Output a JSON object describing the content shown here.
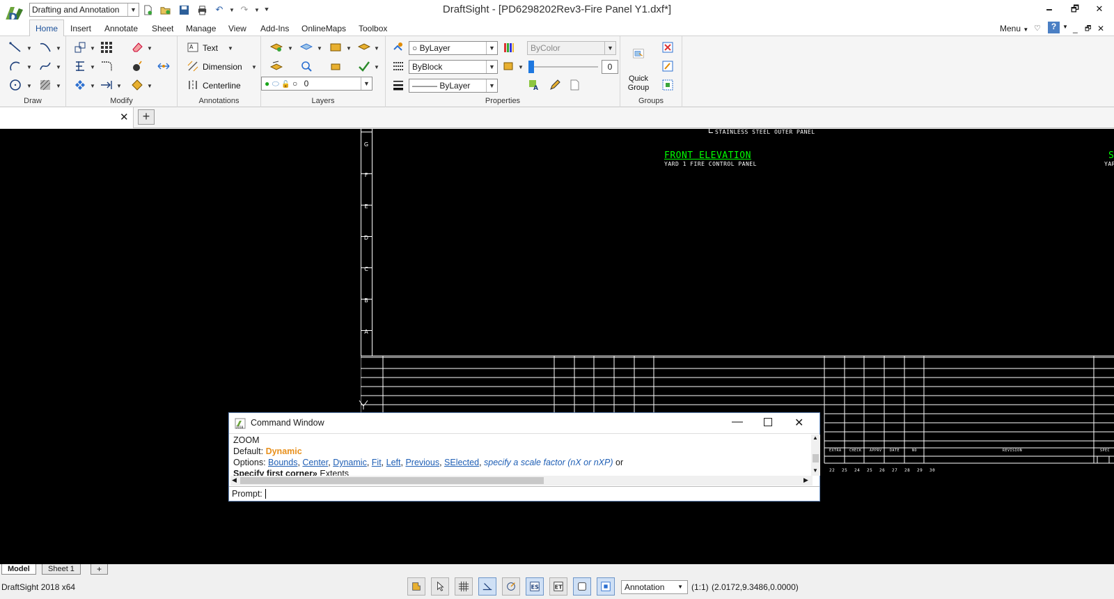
{
  "app": {
    "title": "DraftSight - [PD6298202Rev3-Fire Panel Y1.dxf*]",
    "workspace": "Drafting and Annotation",
    "menu_label": "Menu"
  },
  "ribbon_tabs": [
    "Home",
    "Insert",
    "Annotate",
    "Sheet",
    "Manage",
    "View",
    "Add-Ins",
    "OnlineMaps",
    "Toolbox"
  ],
  "ribbon": {
    "panels": {
      "draw": "Draw",
      "modify": "Modify",
      "annotations": "Annotations",
      "layers": "Layers",
      "properties": "Properties",
      "groups": "Groups"
    },
    "annotations": {
      "text": "Text",
      "dimension": "Dimension",
      "centerline": "Centerline"
    },
    "layers": {
      "current_layer": "0"
    },
    "properties": {
      "color": "ByLayer",
      "linetype": "ByBlock",
      "lineweight": "ByLayer",
      "plot_style": "ByColor",
      "transparency": "0"
    },
    "groups": {
      "quick_group_line1": "Quick",
      "quick_group_line2": "Group"
    }
  },
  "drawing": {
    "outer_panel_note": "STAINLESS STEEL OUTER PANEL",
    "title": "FRONT ELEVATION",
    "subtitle": "YARD 1 FIRE CONTROL PANEL",
    "right_cut_title": "S",
    "right_cut_sub": "YAR",
    "row_labels": [
      "G",
      "F",
      "E",
      "D",
      "C",
      "B",
      "A"
    ],
    "table_headers": [
      "EXTRA",
      "CHECK",
      "APPRV",
      "DATE",
      "NO",
      "REVISION",
      "SPEC"
    ],
    "column_numbers": [
      "22",
      "25",
      "24",
      "25",
      "26",
      "27",
      "28",
      "29",
      "30"
    ]
  },
  "command_window": {
    "title": "Command Window",
    "line1": "ZOOM",
    "default_label": "Default:",
    "default_value": "Dynamic",
    "options_label": "Options:",
    "options": [
      "Bounds",
      "Center",
      "Dynamic",
      "Fit",
      "Left",
      "Previous",
      "SElected"
    ],
    "options_tail_italic": "specify a scale factor (nX or nXP)",
    "options_tail": "or",
    "line4_bold": "Specify first corner»",
    "line4_rest": "Extents",
    "prompt_label": "Prompt:"
  },
  "sheet_tabs": [
    "Model",
    "Sheet 1"
  ],
  "status": {
    "app_version": "DraftSight 2018 x64",
    "annotation_scale": "Annotation",
    "scale": "(1:1)",
    "coordinates": "(2.0172,9.3486,0.0000)"
  },
  "colors": {
    "cad_green": "#00ff00",
    "canvas_bg": "#000000",
    "accent": "#1f5fb5",
    "default_orange": "#e8901c"
  }
}
